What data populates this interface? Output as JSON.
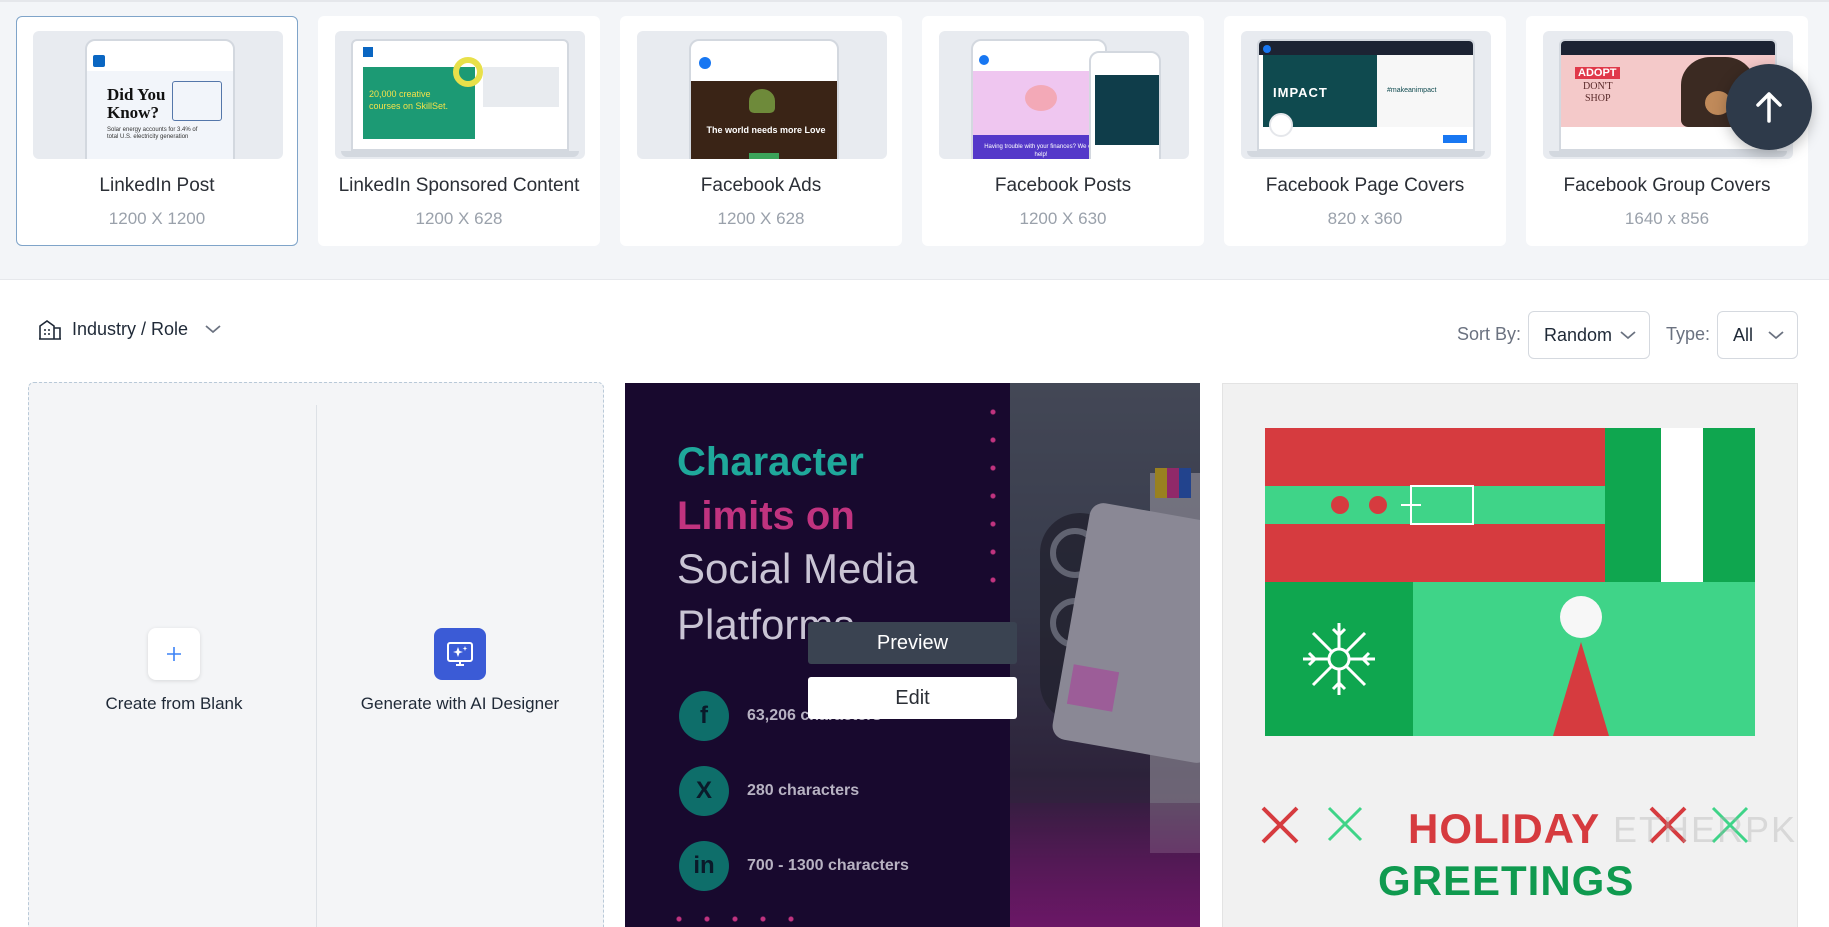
{
  "formats": [
    {
      "name": "LinkedIn Post",
      "size": "1200 X 1200",
      "selected": true
    },
    {
      "name": "LinkedIn Sponsored Content",
      "size": "1200 X 628",
      "selected": false
    },
    {
      "name": "Facebook Ads",
      "size": "1200 X 628",
      "selected": false
    },
    {
      "name": "Facebook Posts",
      "size": "1200 X 630",
      "selected": false
    },
    {
      "name": "Facebook Page Covers",
      "size": "820 x 360",
      "selected": false
    },
    {
      "name": "Facebook Group Covers",
      "size": "1640 x 856",
      "selected": false
    }
  ],
  "thumbs": {
    "linkedin_post": {
      "line1": "Did You",
      "line2": "Know?",
      "body": "Solar energy accounts for 3.4% of total U.S. electricity generation"
    },
    "sponsored": {
      "line1": "20,000 creative",
      "line2": "courses on SkillSet."
    },
    "facebook_ads": {
      "text": "The world needs more Love"
    },
    "facebook_posts": {
      "text": "Having trouble with your finances? We can help!"
    },
    "page_cover": {
      "title": "IMPACT",
      "tag": "#makeanimpact"
    },
    "group_cover": {
      "line1": "ADOPT",
      "line2": "DON'T",
      "line3": "SHOP"
    }
  },
  "filters": {
    "industry_label": "Industry / Role",
    "sort_label": "Sort By:",
    "sort_value": "Random",
    "type_label": "Type:",
    "type_value": "All"
  },
  "create": {
    "blank_label": "Create from Blank",
    "ai_label": "Generate with AI Designer"
  },
  "template1": {
    "heading_line1": "Character",
    "heading_line2": "Limits on",
    "sub_line1": "Social Media",
    "sub_line2": "Platforms",
    "rows": [
      {
        "icon": "f",
        "text": "63,206 characters"
      },
      {
        "icon": "X",
        "text": "280 characters"
      },
      {
        "icon": "in",
        "text": "700 - 1300 characters"
      }
    ],
    "preview_label": "Preview",
    "edit_label": "Edit"
  },
  "template2": {
    "line1": "HOLIDAY",
    "line2": "GREETINGS",
    "watermark": "ETHERPKIN"
  },
  "colors": {
    "accent_blue": "#3b5bd6",
    "teal": "#1fa89b",
    "magenta": "#c0337f",
    "holiday_red": "#d63b3f",
    "holiday_green": "#0f9a4f"
  }
}
